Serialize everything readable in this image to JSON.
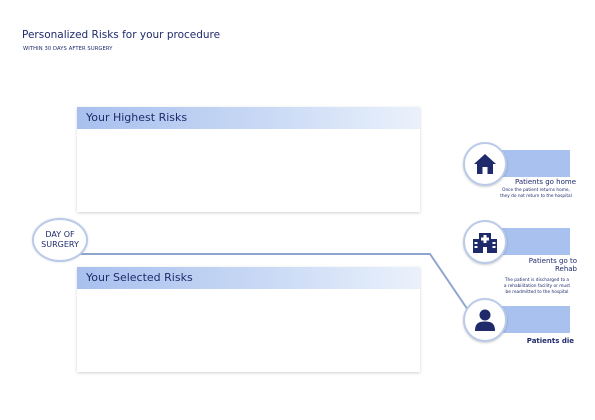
{
  "header": {
    "title": "Personalized Risks for your procedure",
    "subtitle": "WITHIN 30 DAYS AFTER SURGERY"
  },
  "panels": {
    "highest": {
      "title": "Your Highest Risks"
    },
    "selected": {
      "title": "Your Selected Risks"
    }
  },
  "day_of_surgery": {
    "line1": "DAY OF",
    "line2": "SURGERY"
  },
  "outcomes": {
    "home": {
      "label": "Patients go home",
      "desc_line1": "Once the patient returns home,",
      "desc_line2": "they do not return to the hospital",
      "icon": "house-icon"
    },
    "rehab": {
      "label_line1": "Patients go to",
      "label_line2": "Rehab",
      "desc_line1": "The patient is discharged to a",
      "desc_line2": "a rehabilitation facility or must",
      "desc_line3": "be readmitted to the hospital",
      "icon": "hospital-icon"
    },
    "die": {
      "label": "Patients die",
      "icon": "person-icon"
    }
  },
  "colors": {
    "navy": "#1f2a6b",
    "bar": "#a9c1ee",
    "ring": "#b9cbe9",
    "connector": "#8fa6cc"
  }
}
